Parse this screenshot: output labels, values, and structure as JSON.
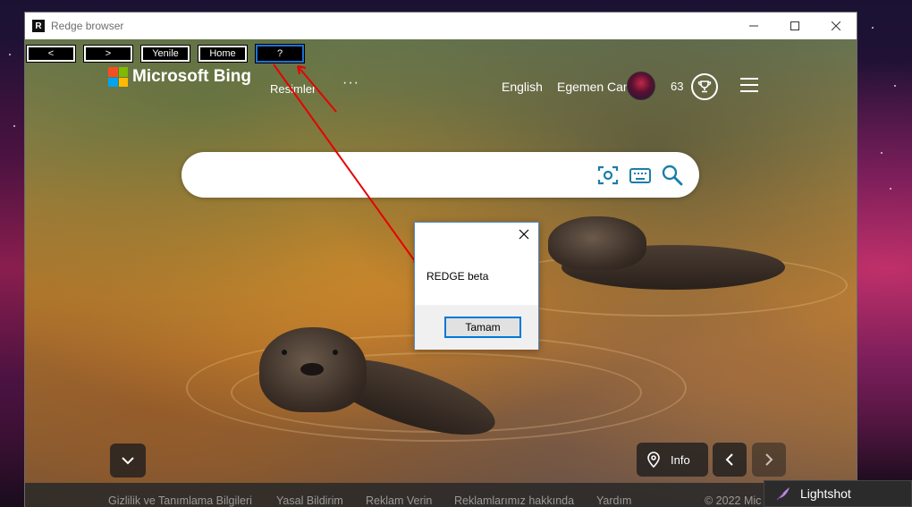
{
  "window": {
    "title": "Redge browser",
    "app_icon_letter": "R"
  },
  "nav": {
    "back": "<",
    "forward": ">",
    "refresh": "Yenile",
    "home": "Home",
    "help": "?"
  },
  "bing": {
    "logo_text": "Microsoft Bing",
    "images_link": "Resimler",
    "more": "···",
    "language": "English",
    "username": "Egemen Can",
    "points": "63"
  },
  "search": {
    "value": "",
    "placeholder": ""
  },
  "controls": {
    "info_label": "Info"
  },
  "footer": {
    "links": [
      "Gizlilik ve Tanımlama Bilgileri",
      "Yasal Bildirim",
      "Reklam Verin",
      "Reklamlarımız hakkında",
      "Yardım"
    ],
    "copyright": "© 2022 Mic"
  },
  "dialog": {
    "message": "REDGE beta",
    "ok_label": "Tamam"
  },
  "taskbar": {
    "lightshot_label": "Lightshot"
  },
  "colors": {
    "accent": "#0078d7",
    "annotation": "#e60000",
    "search_icon": "#1a7ea8"
  }
}
